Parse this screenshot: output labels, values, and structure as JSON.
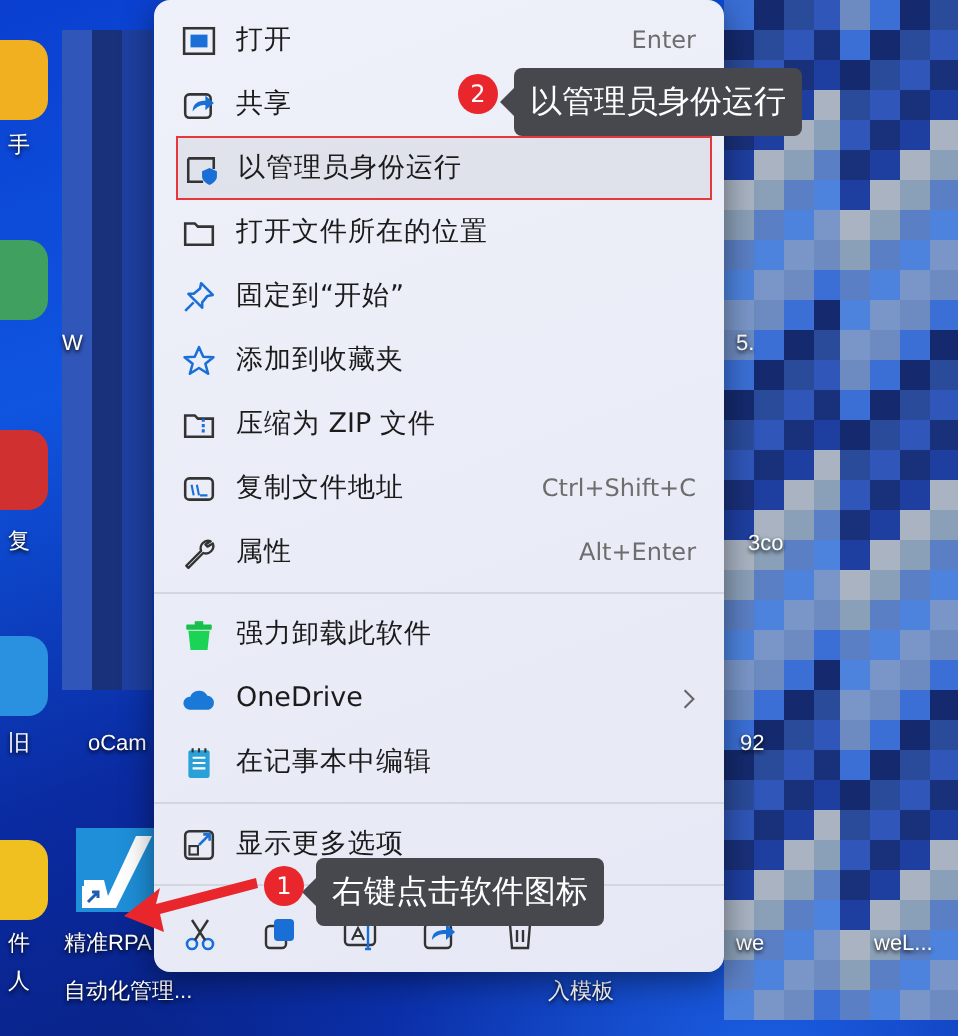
{
  "desktop": {
    "labels": [
      {
        "text": "手"
      },
      {
        "text": "W"
      },
      {
        "text": "复"
      },
      {
        "text": "旧"
      },
      {
        "text": "oCam"
      },
      {
        "text": "件"
      },
      {
        "text": "人"
      },
      {
        "text": "精准RPA"
      },
      {
        "text": "自动化管理..."
      },
      {
        "text": "5."
      },
      {
        "text": "3co"
      },
      {
        "text": "92"
      },
      {
        "text": "we"
      },
      {
        "text": "weL..."
      },
      {
        "text": "入模板"
      }
    ]
  },
  "context_menu": {
    "items": [
      {
        "kind": "command",
        "label": "打开",
        "shortcut": "Enter",
        "selected": false
      },
      {
        "kind": "command",
        "label": "共享",
        "selected": false
      },
      {
        "kind": "command",
        "label": "以管理员身份运行",
        "selected": true
      },
      {
        "kind": "command",
        "label": "打开文件所在的位置",
        "selected": false
      },
      {
        "kind": "command",
        "label": "固定到“开始”",
        "selected": false
      },
      {
        "kind": "command",
        "label": "添加到收藏夹",
        "selected": false
      },
      {
        "kind": "command",
        "label": "压缩为 ZIP 文件",
        "selected": false
      },
      {
        "kind": "command",
        "label": "复制文件地址",
        "shortcut": "Ctrl+Shift+C",
        "selected": false
      },
      {
        "kind": "command",
        "label": "属性",
        "shortcut": "Alt+Enter",
        "selected": false
      },
      {
        "kind": "separator"
      },
      {
        "kind": "command",
        "label": "强力卸载此软件",
        "selected": false
      },
      {
        "kind": "command",
        "label": "OneDrive",
        "submenu": true,
        "selected": false
      },
      {
        "kind": "command",
        "label": "在记事本中编辑",
        "selected": false
      },
      {
        "kind": "separator"
      },
      {
        "kind": "command",
        "label": "显示更多选项",
        "selected": false
      },
      {
        "kind": "separator"
      },
      {
        "kind": "actions"
      }
    ]
  },
  "annotations": [
    {
      "number": "2",
      "text": "以管理员身份运行"
    },
    {
      "number": "1",
      "text": "右键点击软件图标"
    }
  ]
}
